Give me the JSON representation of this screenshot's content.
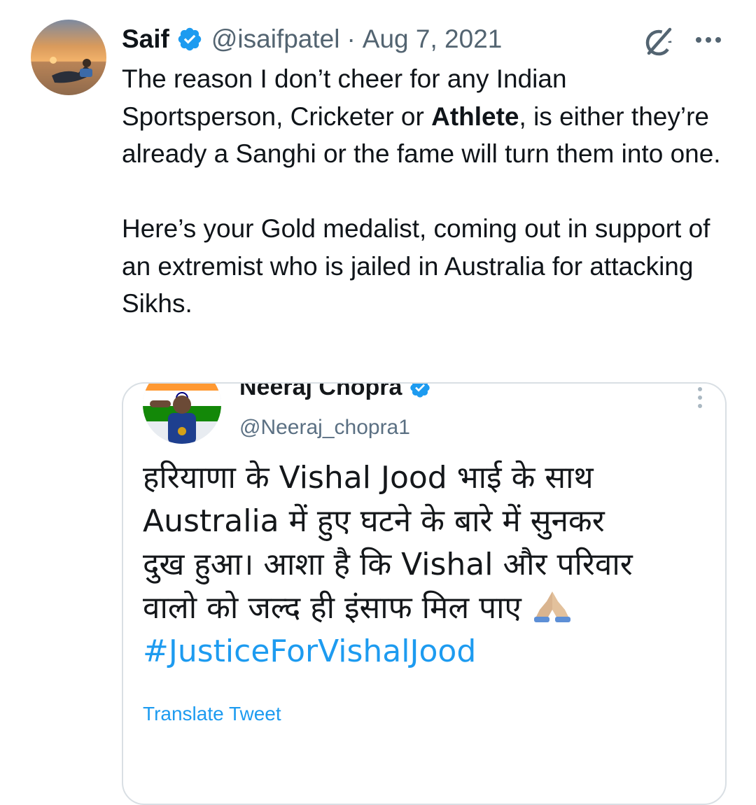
{
  "tweet": {
    "author_name": "Saif",
    "handle": "@isaifpatel",
    "separator": "·",
    "date": "Aug 7, 2021",
    "text_p1_a": "The reason I don’t cheer for any Indian Sportsperson, Cricketer or ",
    "text_p1_bold": "Athlete",
    "text_p1_b": ", is either they’re already a Sanghi or the fame will turn them into one.",
    "text_p2": "Here’s your Gold medalist, coming out in support of an extremist who is jailed in Australia for attacking Sikhs."
  },
  "icons": {
    "verified": "verified-badge-icon",
    "grok": "grok-icon",
    "more": "more-options-icon"
  },
  "embedded_tweet": {
    "author_name": "Neeraj Chopra",
    "handle": "@Neeraj_chopra1",
    "line1": "हरियाणा के Vishal Jood भाई के साथ",
    "line2": "Australia में हुए घटने के बारे में सुनकर",
    "line3": "दुख हुआ। आशा है कि Vishal और परिवार",
    "line4": "वालो को जल्द ही इंसाफ मिल पाए",
    "emoji": "🙏🏼",
    "hashtag": "#JusticeForVishalJood",
    "translate_label": "Translate Tweet"
  },
  "colors": {
    "verified_blue": "#1d9bf0",
    "text_primary": "#0f1419",
    "text_secondary": "#536471",
    "link_blue": "#1d9bf0",
    "border": "#d9dfe4"
  }
}
